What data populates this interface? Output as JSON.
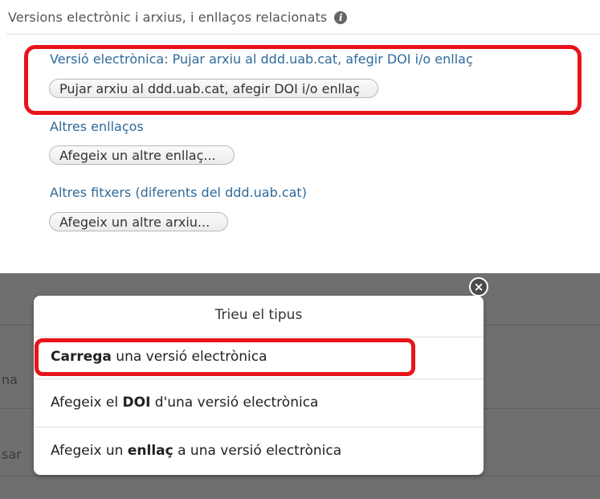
{
  "section": {
    "title": "Versions electrònic i arxius, i enllaços relacionats",
    "info_icon": "i"
  },
  "electronic_version": {
    "heading": "Versió electrònica: Pujar arxiu al ddd.uab.cat, afegir DOI i/o enllaç",
    "button": "Pujar arxiu al ddd.uab.cat, afegir DOI i/o enllaç"
  },
  "other_links": {
    "heading": "Altres enllaços",
    "button": "Afegeix un altre enllaç..."
  },
  "other_files": {
    "heading": "Altres fitxers (diferents del ddd.uab.cat)",
    "button": "Afegeix un altre arxiu..."
  },
  "background_fragments": {
    "first": "na",
    "second": "sar"
  },
  "modal": {
    "title": "Trieu el tipus",
    "close_icon": "×",
    "options": [
      {
        "bold": "Carrega",
        "rest": " una versió electrònica"
      },
      {
        "pre": "Afegeix el ",
        "bold": "DOI",
        "rest": " d'una versió electrònica"
      },
      {
        "pre": "Afegeix un ",
        "bold": "enllaç",
        "rest": " a una versió electrònica"
      }
    ]
  },
  "colors": {
    "link": "#2f6a9a",
    "highlight": "#e8141b",
    "overlay": "#6f6f6f"
  }
}
